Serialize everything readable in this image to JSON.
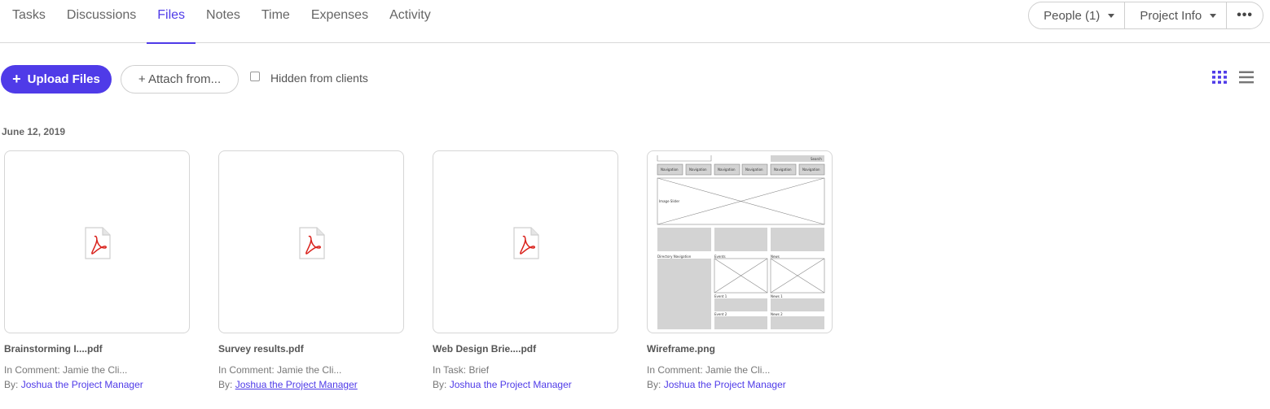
{
  "nav": {
    "tabs": [
      "Tasks",
      "Discussions",
      "Files",
      "Notes",
      "Time",
      "Expenses",
      "Activity"
    ],
    "active_tab": "Files",
    "people_label": "People (1)",
    "project_info_label": "Project Info",
    "more_label": "•••"
  },
  "toolbar": {
    "upload_label": "Upload Files",
    "attach_label": "+ Attach from...",
    "hidden_label": "Hidden from clients",
    "hidden_checked": false
  },
  "files": {
    "date_heading": "June 12, 2019",
    "by_prefix": "By:",
    "items": [
      {
        "name": "Brainstorming I....pdf",
        "context": "In Comment: Jamie the Cli...",
        "author": "Joshua the Project Manager",
        "type": "pdf"
      },
      {
        "name": "Survey results.pdf",
        "context": "In Comment: Jamie the Cli...",
        "author": "Joshua the Project Manager",
        "type": "pdf"
      },
      {
        "name": "Web Design Brie....pdf",
        "context": "In Task: Brief",
        "author": "Joshua the Project Manager",
        "type": "pdf"
      },
      {
        "name": "Wireframe.png",
        "context": "In Comment: Jamie the Cli...",
        "author": "Joshua the Project Manager",
        "type": "image"
      }
    ]
  },
  "wireframe": {
    "search": "Search",
    "nav_item": "Navigation",
    "slider": "Image Slider",
    "directory": "Directory Navigation",
    "events": "Events",
    "news": "News",
    "event1": "Event 1",
    "event2": "Event 2",
    "news1": "News 1",
    "news2": "News 2"
  },
  "colors": {
    "accent": "#4f3be8",
    "pdf_red": "#d9221c"
  }
}
